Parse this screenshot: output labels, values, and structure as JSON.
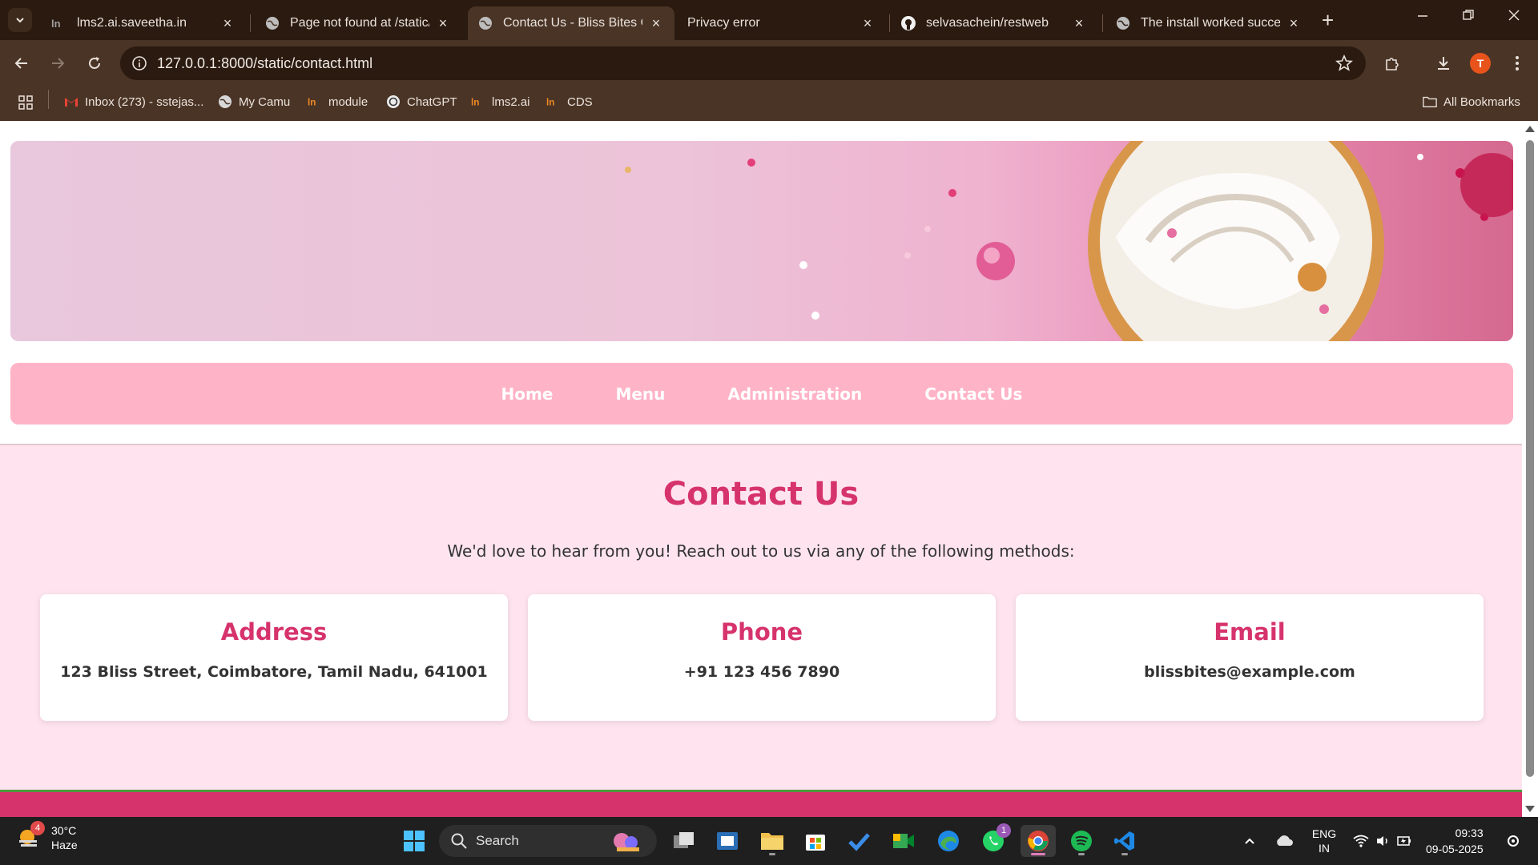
{
  "browser": {
    "tabs": [
      {
        "title": "lms2.ai.saveetha.in",
        "active": false
      },
      {
        "title": "Page not found at /static/i",
        "active": false
      },
      {
        "title": "Contact Us - Bliss Bites Caf",
        "active": true
      },
      {
        "title": "Privacy error",
        "active": false
      },
      {
        "title": "selvasachein/restweb",
        "active": false
      },
      {
        "title": "The install worked success",
        "active": false
      }
    ],
    "url": "127.0.0.1:8000/static/contact.html",
    "profile_initial": "T",
    "bookmarks": [
      {
        "label": "Inbox (273) - sstejas...",
        "icon": "gmail-icon"
      },
      {
        "label": "My Camu",
        "icon": "globe-icon"
      },
      {
        "label": "module",
        "icon": "lms-icon"
      },
      {
        "label": "ChatGPT",
        "icon": "chatgpt-icon"
      },
      {
        "label": "lms2.ai",
        "icon": "lms-icon"
      },
      {
        "label": "CDS",
        "icon": "lms-icon"
      }
    ],
    "all_bookmarks_label": "All Bookmarks"
  },
  "page": {
    "nav": [
      "Home",
      "Menu",
      "Administration",
      "Contact Us"
    ],
    "heading": "Contact Us",
    "intro": "We'd love to hear from you! Reach out to us via any of the following methods:",
    "cards": [
      {
        "title": "Address",
        "value": "123 Bliss Street, Coimbatore, Tamil Nadu, 641001"
      },
      {
        "title": "Phone",
        "value": "+91 123 456 7890"
      },
      {
        "title": "Email",
        "value": "blissbites@example.com"
      }
    ],
    "colors": {
      "accent": "#d6336c",
      "nav_bg": "#ffb3c6",
      "section_bg": "#ffe4ef"
    }
  },
  "taskbar": {
    "weather_temp": "30°C",
    "weather_desc": "Haze",
    "weather_badge": "4",
    "search_placeholder": "Search",
    "whatsapp_badge": "1",
    "lang_top": "ENG",
    "lang_bottom": "IN",
    "time": "09:33",
    "date": "09-05-2025"
  }
}
